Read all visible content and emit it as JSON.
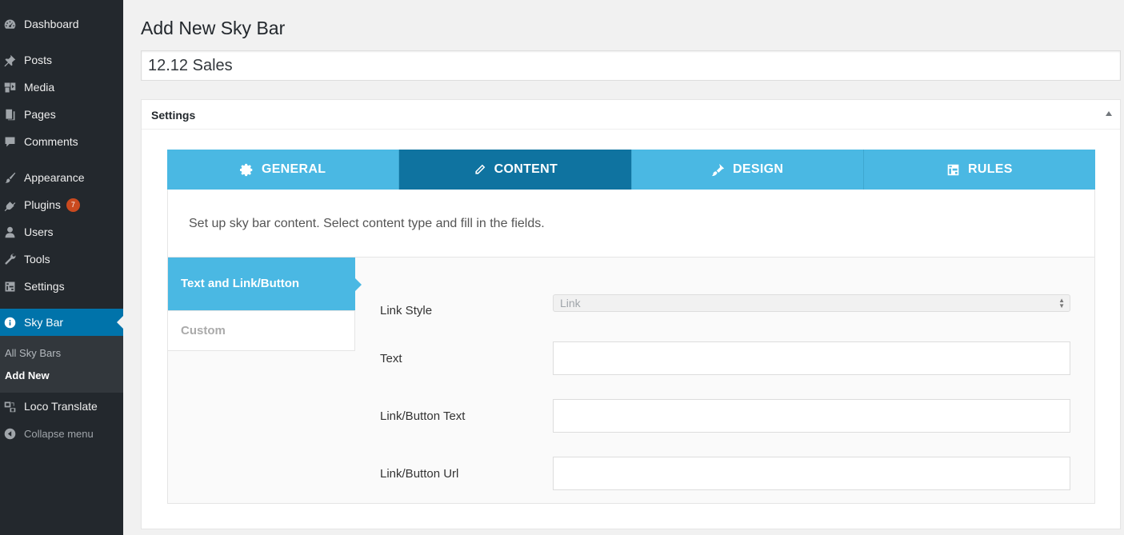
{
  "sidebar": {
    "items": [
      {
        "label": "Dashboard",
        "icon": "dashboard-icon"
      },
      {
        "label": "Posts",
        "icon": "pin-icon"
      },
      {
        "label": "Media",
        "icon": "media-icon"
      },
      {
        "label": "Pages",
        "icon": "pages-icon"
      },
      {
        "label": "Comments",
        "icon": "comment-icon"
      },
      {
        "label": "Appearance",
        "icon": "brush-icon"
      },
      {
        "label": "Plugins",
        "icon": "plugin-icon",
        "badge": "7"
      },
      {
        "label": "Users",
        "icon": "user-icon"
      },
      {
        "label": "Tools",
        "icon": "wrench-icon"
      },
      {
        "label": "Settings",
        "icon": "settings-icon"
      },
      {
        "label": "Sky Bar",
        "icon": "info-icon"
      },
      {
        "label": "Loco Translate",
        "icon": "translate-icon"
      },
      {
        "label": "Collapse menu",
        "icon": "collapse-icon"
      }
    ],
    "submenu": [
      "All Sky Bars",
      "Add New"
    ]
  },
  "page": {
    "title": "Add New Sky Bar",
    "post_title_value": "12.12 Sales"
  },
  "settings": {
    "title": "Settings",
    "tabs": [
      {
        "label": "GENERAL",
        "icon": "gear-icon"
      },
      {
        "label": "CONTENT",
        "icon": "pencil-icon"
      },
      {
        "label": "DESIGN",
        "icon": "paint-brush-icon"
      },
      {
        "label": "RULES",
        "icon": "rules-icon"
      }
    ],
    "description": "Set up sky bar content. Select content type and fill in the fields.",
    "subtabs": [
      "Text and Link/Button",
      "Custom"
    ],
    "fields": {
      "link_style_label": "Link Style",
      "link_style_value": "Link",
      "text_label": "Text",
      "text_value": "",
      "button_text_label": "Link/Button Text",
      "button_text_value": "",
      "button_url_label": "Link/Button Url",
      "button_url_value": ""
    }
  },
  "colors": {
    "sidebar_bg": "#23282d",
    "active_menu": "#0073aa",
    "tab_bg": "#4ab8e3",
    "tab_active": "#0f73a0",
    "badge": "#ca4a1f"
  }
}
